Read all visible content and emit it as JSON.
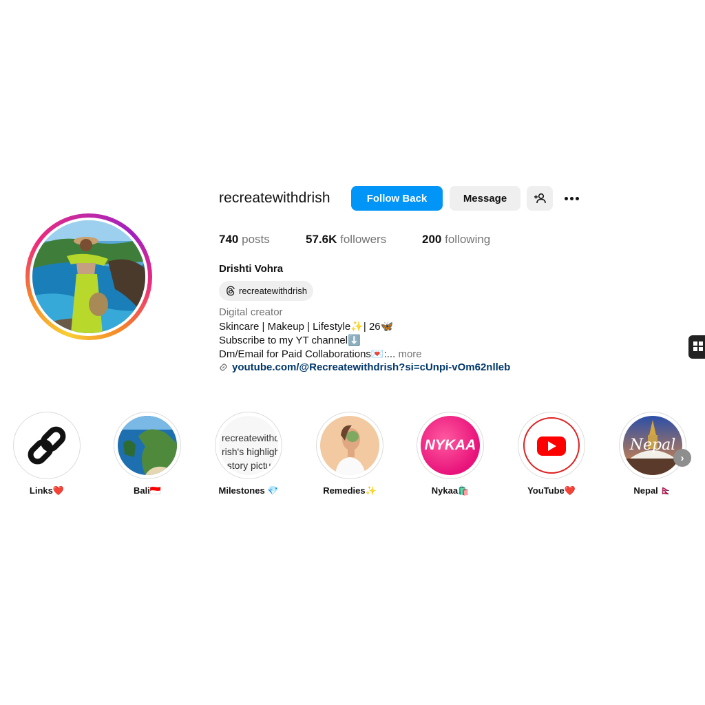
{
  "profile": {
    "username": "recreatewithdrish",
    "follow_back_label": "Follow Back",
    "message_label": "Message",
    "add_user_icon": "add-user-icon",
    "more_icon": "more-options-icon",
    "full_name": "Drishti Vohra",
    "threads_handle": "recreatewithdrish",
    "category": "Digital creator",
    "bio_line1": "Skincare | Makeup | Lifestyle✨| 26🦋",
    "bio_line2": "Subscribe to my YT channel⬇️",
    "bio_line3": "Dm/Email for Paid Collaborations💌:...",
    "bio_more": "more",
    "link": "youtube.com/@Recreatewithdrish?si=cUnpi-vOm62nlleb"
  },
  "stats": {
    "posts_count": "740",
    "posts_label": "posts",
    "followers_count": "57.6K",
    "followers_label": "followers",
    "following_count": "200",
    "following_label": "following"
  },
  "highlights": [
    {
      "label": "Links❤️"
    },
    {
      "label": "Bali🇮🇩"
    },
    {
      "label": "Milestones 💎",
      "broken_alt": "recreatewithdrish's highlight story picture"
    },
    {
      "label": "Remedies✨"
    },
    {
      "label": "Nykaa🛍️",
      "image_text": "NYKAA"
    },
    {
      "label": "YouTube❤️"
    },
    {
      "label": "Nepal 🇳🇵",
      "image_text": "Nepal"
    }
  ],
  "colors": {
    "accent": "#0095f6",
    "link": "#00376b",
    "muted": "#737373",
    "button_gray": "#efefef"
  }
}
